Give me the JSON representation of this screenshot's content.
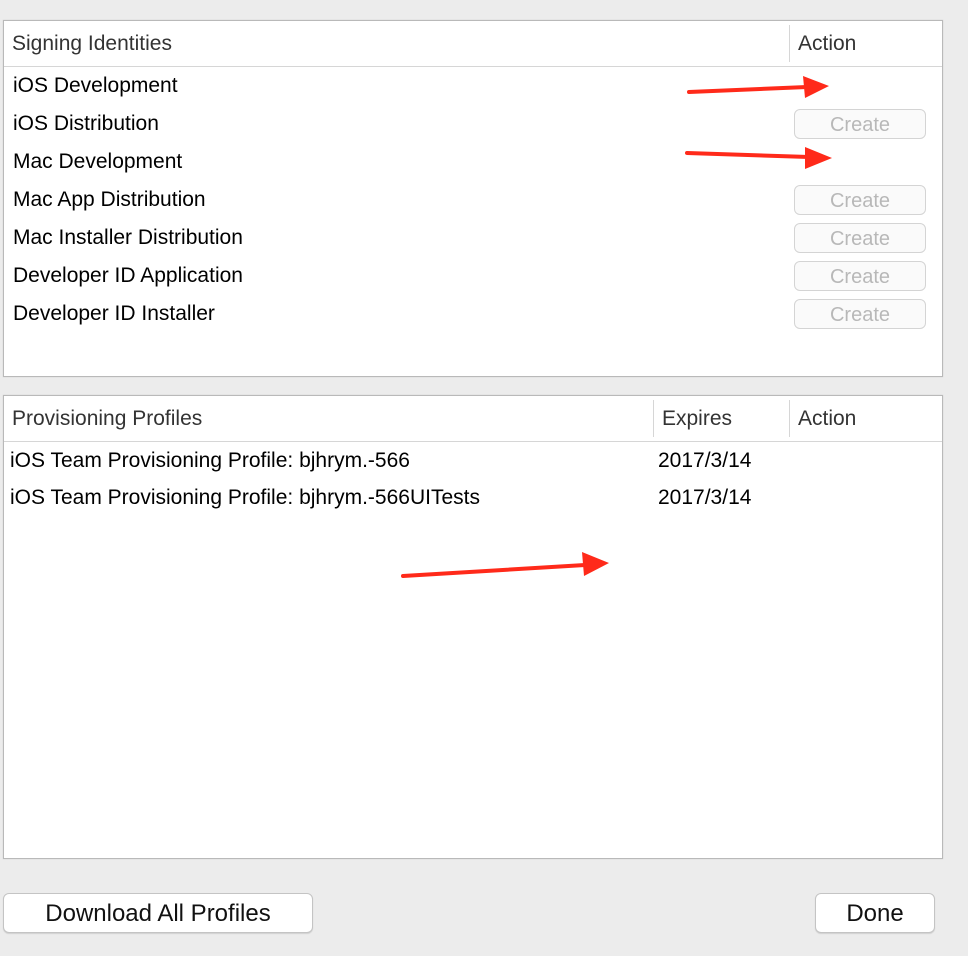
{
  "signing_identities": {
    "header": {
      "name": "Signing Identities",
      "action": "Action"
    },
    "rows": [
      {
        "name": "iOS Development",
        "action": ""
      },
      {
        "name": "iOS Distribution",
        "action": "Create"
      },
      {
        "name": "Mac Development",
        "action": ""
      },
      {
        "name": "Mac App Distribution",
        "action": "Create"
      },
      {
        "name": "Mac Installer Distribution",
        "action": "Create"
      },
      {
        "name": "Developer ID Application",
        "action": "Create"
      },
      {
        "name": "Developer ID Installer",
        "action": "Create"
      }
    ]
  },
  "provisioning_profiles": {
    "header": {
      "name": "Provisioning Profiles",
      "expires": "Expires",
      "action": "Action"
    },
    "rows": [
      {
        "name": "iOS Team Provisioning Profile: bjhrym.-566",
        "expires": "2017/3/14"
      },
      {
        "name": "iOS Team Provisioning Profile: bjhrym.-566UITests",
        "expires": "2017/3/14"
      }
    ]
  },
  "buttons": {
    "download_all": "Download All Profiles",
    "done": "Done"
  },
  "colors": {
    "annotation_arrow": "#ff2a1a",
    "disabled_button_text": "#b8b8b8"
  }
}
